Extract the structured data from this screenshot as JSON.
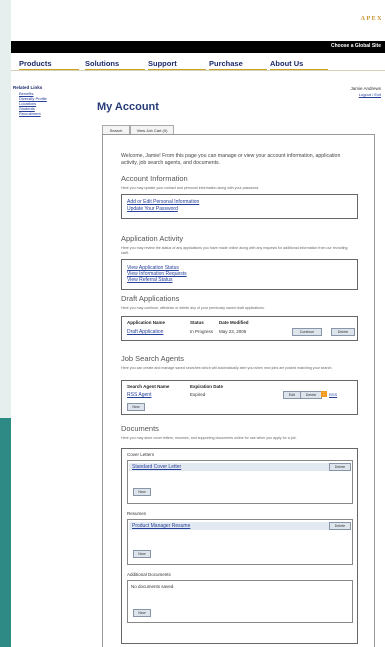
{
  "header": {
    "logo": "APEX",
    "global_site": "Choose a Global Site"
  },
  "nav": {
    "items": [
      {
        "label": "Products"
      },
      {
        "label": "Solutions"
      },
      {
        "label": "Support"
      },
      {
        "label": "Purchase"
      },
      {
        "label": "About Us"
      }
    ]
  },
  "sidebar": {
    "title": "Related Links",
    "links": [
      "Benefits",
      "Diversity Profile",
      "Locations",
      "Students",
      "Recruitment"
    ]
  },
  "user": {
    "name": "Jamie Andrews",
    "logout": "Logout / Exit"
  },
  "page": {
    "title": "My Account",
    "tabs": [
      "Search",
      "View Job Cart (0)"
    ],
    "intro": "Welcome, Jamie! From this page you can manage or view your account information, application activity, job search agents, and documents."
  },
  "account": {
    "title": "Account Information",
    "desc": "Here you may update your contact and personal information along with your password.",
    "links": [
      "Add or Edit Personal Information",
      "Update Your Password"
    ]
  },
  "activity": {
    "title": "Application Activity",
    "desc": "Here you may review the status of any applications you have made online along with any requests for additional information from our recruiting staff.",
    "links": [
      "View Application Status",
      "View Information Requests",
      "View Referral Status"
    ]
  },
  "drafts": {
    "title": "Draft Applications",
    "desc": "Here you may continue, withdraw or delete any of your previously saved draft applications.",
    "headers": [
      "Application Name",
      "Status",
      "Date Modified"
    ],
    "row": {
      "name": "Draft Application",
      "status": "In Progress",
      "date": "May 23, 2006",
      "continue": "Continue",
      "delete": "Delete"
    }
  },
  "agents": {
    "title": "Job Search Agents",
    "desc": "Here you can create and manage saved searches which will automatically alert you when new jobs are posted matching your search.",
    "headers": [
      "Search Agent Name",
      "Expiration Date"
    ],
    "row": {
      "name": "RSS Agent",
      "expiration": "Expired",
      "edit": "Edit",
      "delete": "Delete",
      "rss": "RSS"
    },
    "new_button": "New"
  },
  "documents": {
    "title": "Documents",
    "desc": "Here you may store cover letters, resumes, and supporting documents online for use when you apply for a job.",
    "cover": {
      "label": "Cover Letters",
      "item": "Standard Cover Letter",
      "delete": "Delete",
      "new": "New"
    },
    "resumes": {
      "label": "Resumes",
      "item": "Product Manager Resume",
      "delete": "Delete",
      "new": "New"
    },
    "additional": {
      "label": "Additional Documents",
      "empty": "No documents saved.",
      "new": "New"
    }
  }
}
